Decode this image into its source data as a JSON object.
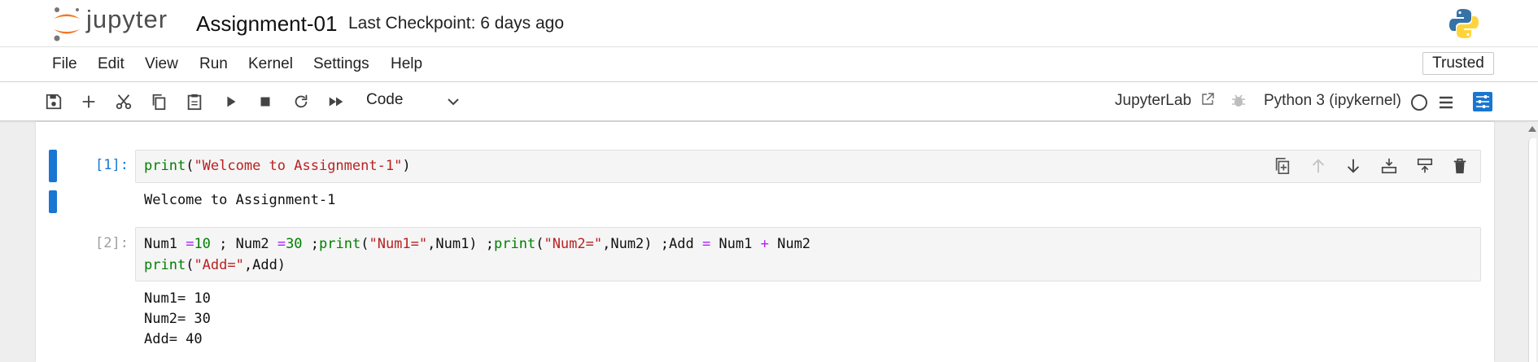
{
  "header": {
    "logo_text": "jupyter",
    "notebook_title": "Assignment-01",
    "checkpoint": "Last Checkpoint: 6 days ago"
  },
  "menu": {
    "items": [
      "File",
      "Edit",
      "View",
      "Run",
      "Kernel",
      "Settings",
      "Help"
    ],
    "trusted": "Trusted"
  },
  "toolbar": {
    "cell_type": "Code",
    "jupyterlab_link": "JupyterLab",
    "kernel_name": "Python 3 (ipykernel)"
  },
  "cells": [
    {
      "prompt": "[1]:",
      "code_parts": [
        "print",
        "(",
        "\"Welcome to Assignment-1\"",
        ")"
      ],
      "output": "Welcome to Assignment-1"
    },
    {
      "prompt": "[2]:",
      "code_line1_parts": [
        "Num1 ",
        "=",
        "10",
        " ; Num2 ",
        "=",
        "30",
        " ;",
        "print",
        "(",
        "\"Num1=\"",
        ",Num1) ;",
        "print",
        "(",
        "\"Num2=\"",
        ",Num2) ;Add ",
        "=",
        " Num1 ",
        "+",
        " Num2"
      ],
      "code_line2_parts": [
        "print",
        "(",
        "\"Add=\"",
        ",Add)"
      ],
      "output_lines": [
        "Num1= 10",
        "Num2= 30",
        "Add= 40"
      ]
    }
  ],
  "colors": {
    "accent": "#1976d2",
    "keyword": "#008000",
    "string": "#ba2121",
    "operator": "#aa22ff"
  }
}
